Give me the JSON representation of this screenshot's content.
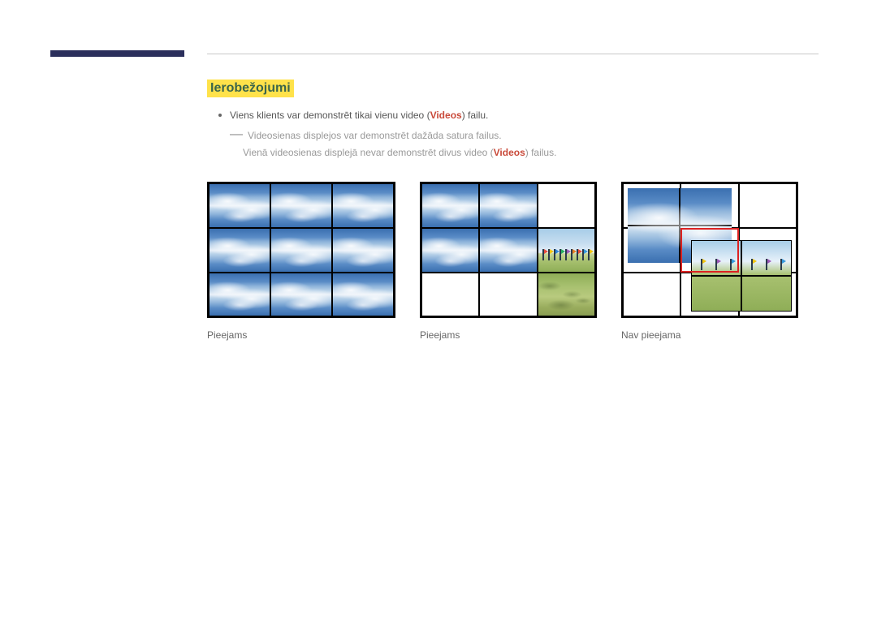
{
  "heading": "Ierobežojumi",
  "bullet": {
    "prefix": "Viens klients var demonstrēt tikai vienu video (",
    "highlight": "Videos",
    "suffix": ") failu."
  },
  "sub1": "Videosienas displejos var demonstrēt dažāda satura failus.",
  "sub2": {
    "prefix": "Vienā videosienas displejā nevar demonstrēt divus video (",
    "highlight": "Videos",
    "suffix": ") failus."
  },
  "captions": {
    "fig1": "Pieejams",
    "fig2": "Pieejams",
    "fig3": "Nav pieejama"
  }
}
